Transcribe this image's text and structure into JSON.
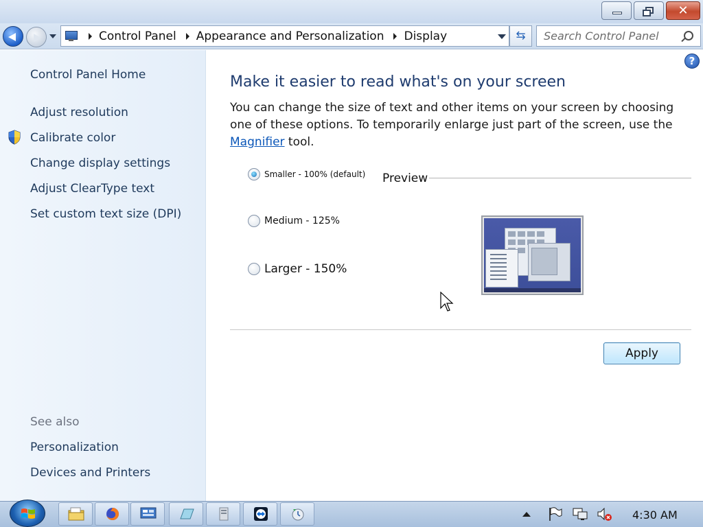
{
  "navigation": {
    "breadcrumbs": [
      "Control Panel",
      "Appearance and Personalization",
      "Display"
    ],
    "search_placeholder": "Search Control Panel"
  },
  "sidebar": {
    "home": "Control Panel Home",
    "links": [
      "Adjust resolution",
      "Calibrate color",
      "Change display settings",
      "Adjust ClearType text",
      "Set custom text size (DPI)"
    ],
    "see_also_label": "See also",
    "see_also": [
      "Personalization",
      "Devices and Printers"
    ]
  },
  "main": {
    "heading": "Make it easier to read what's on your screen",
    "description_before": "You can change the size of text and other items on your screen by choosing one of these options. To temporarily enlarge just part of the screen, use the ",
    "magnifier_link": "Magnifier",
    "description_after": " tool.",
    "options": [
      {
        "label": "Smaller - 100% (default)",
        "checked": true
      },
      {
        "label": "Medium - 125%",
        "checked": false
      },
      {
        "label": "Larger - 150%",
        "checked": false
      }
    ],
    "preview_label": "Preview",
    "apply_button": "Apply"
  },
  "taskbar": {
    "clock": "4:30 AM"
  },
  "icons": {
    "back": "back-arrow-icon",
    "forward": "forward-arrow-icon",
    "refresh": "refresh-icon",
    "search": "search-icon",
    "help": "help-icon",
    "shield": "uac-shield-icon",
    "taskbar_apps": [
      "file-explorer-icon",
      "firefox-icon",
      "control-panel-icon",
      "notepad-icon",
      "file-manager-icon",
      "teamviewer-icon",
      "backup-icon"
    ],
    "tray": [
      "action-center-flag-icon",
      "network-icon",
      "volume-muted-icon"
    ]
  }
}
